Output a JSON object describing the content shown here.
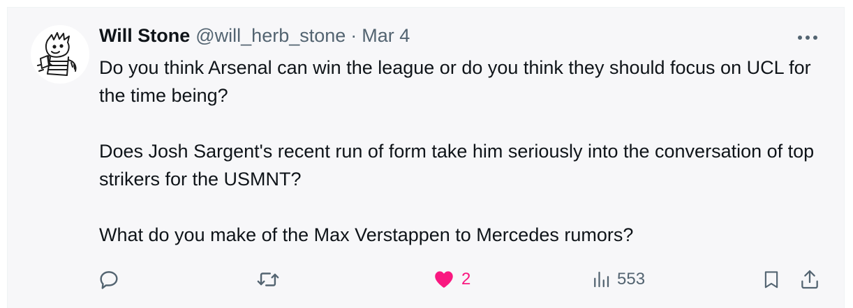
{
  "author": {
    "name": "Will Stone",
    "handle": "@will_herb_stone",
    "separator": "·",
    "date": "Mar 4",
    "avatar_icon": "cartoon-avatar-icon"
  },
  "tweet": {
    "paragraphs": [
      "Do you think Arsenal can win the league or do you think they should focus on UCL for the time being?",
      "Does Josh Sargent's recent run of form take him seriously into the conversation of top strikers for the USMNT?",
      "What do you make of the Max Verstappen to Mercedes rumors?"
    ]
  },
  "actions": {
    "reply": {
      "icon": "reply-icon"
    },
    "retweet": {
      "icon": "retweet-icon"
    },
    "like": {
      "icon": "heart-icon",
      "count": "2",
      "liked": true,
      "color": "#f91880"
    },
    "views": {
      "icon": "views-icon",
      "count": "553"
    },
    "bookmark": {
      "icon": "bookmark-icon"
    },
    "share": {
      "icon": "share-icon"
    }
  },
  "colors": {
    "text_primary": "#0f1419",
    "text_secondary": "#536471",
    "like": "#f91880",
    "background": "#f7f7f9"
  }
}
